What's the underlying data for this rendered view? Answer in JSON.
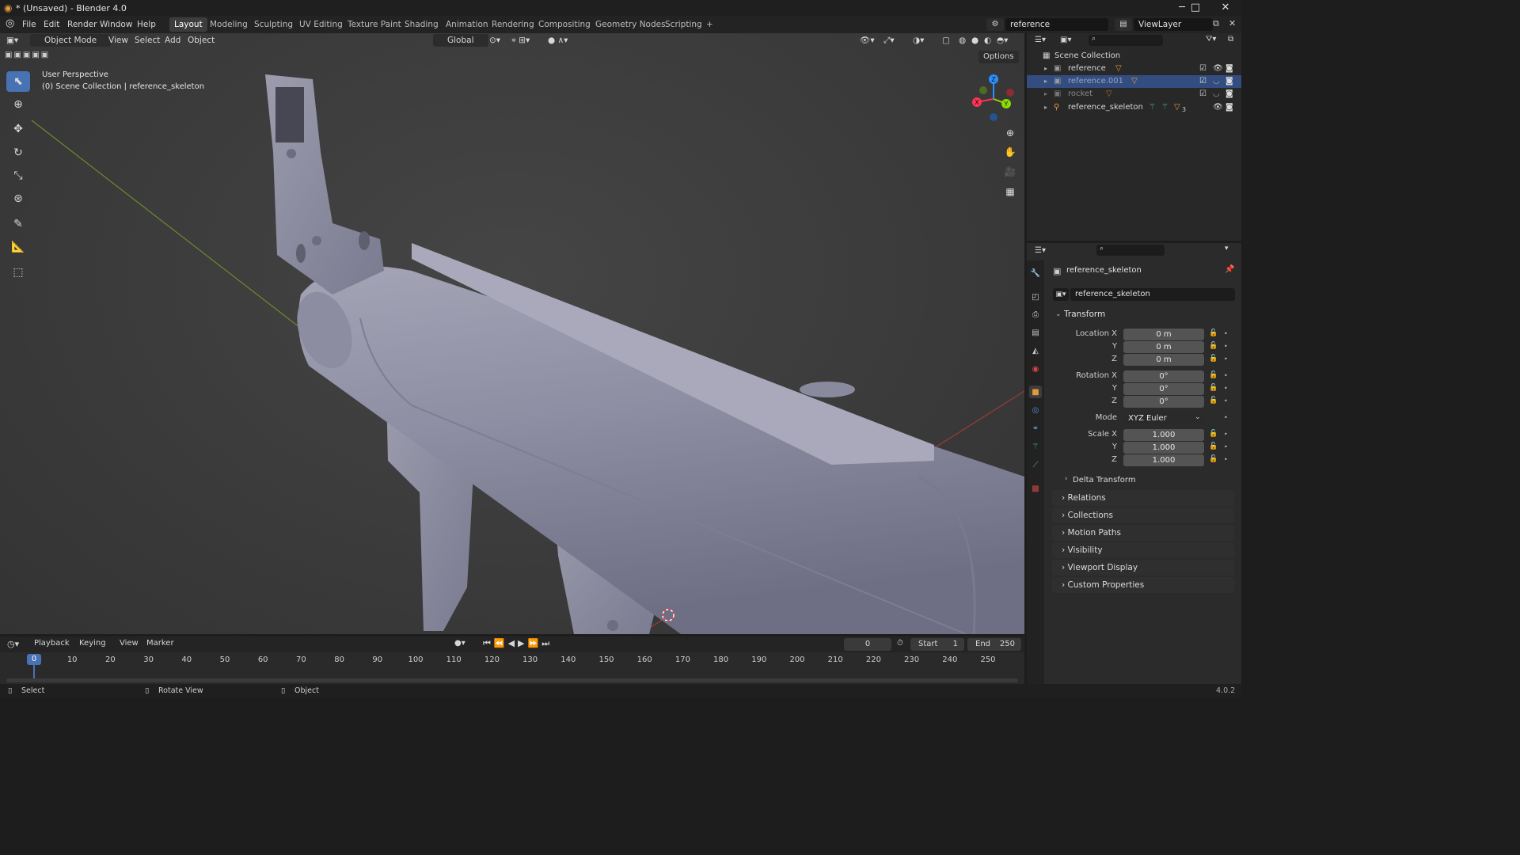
{
  "window": {
    "title": "* (Unsaved) - Blender 4.0",
    "minimize": "─",
    "maximize": "□",
    "close": "✕"
  },
  "menu": {
    "items": [
      "File",
      "Edit",
      "Render",
      "Window",
      "Help"
    ]
  },
  "workspaces": {
    "tabs": [
      "Layout",
      "Modeling",
      "Sculpting",
      "UV Editing",
      "Texture Paint",
      "Shading",
      "Animation",
      "Rendering",
      "Compositing",
      "Geometry Nodes",
      "Scripting"
    ],
    "active": "Layout",
    "add": "+"
  },
  "scene_field": {
    "value": "reference"
  },
  "viewlayer_field": {
    "value": "ViewLayer"
  },
  "viewport_header": {
    "mode": "Object Mode",
    "menus": [
      "View",
      "Select",
      "Add",
      "Object"
    ],
    "orientation": "Global",
    "options": "Options"
  },
  "viewport_overlay": {
    "perspective": "User Perspective",
    "context": "(0) Scene Collection | reference_skeleton"
  },
  "gizmo": {
    "z": "Z",
    "y": "Y",
    "x": "X"
  },
  "outliner": {
    "root": "Scene Collection",
    "items": [
      {
        "name": "reference",
        "state": "normal"
      },
      {
        "name": "reference.001",
        "state": "selected"
      },
      {
        "name": "rocket",
        "state": "dim"
      },
      {
        "name": "reference_skeleton",
        "state": "normal",
        "badge": "3"
      }
    ]
  },
  "properties": {
    "object_name": "reference_skeleton",
    "datablock": "reference_skeleton",
    "transform_header": "Transform",
    "location": {
      "label": "Location X",
      "x": "0 m",
      "y": "0 m",
      "z": "0 m"
    },
    "rotation": {
      "label": "Rotation X",
      "x": "0°",
      "y": "0°",
      "z": "0°"
    },
    "mode": {
      "label": "Mode",
      "value": "XYZ Euler"
    },
    "scale": {
      "label": "Scale X",
      "x": "1.000",
      "y": "1.000",
      "z": "1.000"
    },
    "axis_y": "Y",
    "axis_z": "Z",
    "delta_transform": "Delta Transform",
    "sections": [
      "Relations",
      "Collections",
      "Motion Paths",
      "Visibility",
      "Viewport Display",
      "Custom Properties"
    ]
  },
  "timeline": {
    "menus": [
      "Playback",
      "Keying",
      "View",
      "Marker"
    ],
    "current_frame": "0",
    "start_label": "Start",
    "start": "1",
    "end_label": "End",
    "end": "250",
    "ticks": [
      "0",
      "10",
      "20",
      "30",
      "40",
      "50",
      "60",
      "70",
      "80",
      "90",
      "100",
      "110",
      "120",
      "130",
      "140",
      "150",
      "160",
      "170",
      "180",
      "190",
      "200",
      "210",
      "220",
      "230",
      "240",
      "250"
    ]
  },
  "statusbar": {
    "select": "Select",
    "rotate": "Rotate View",
    "object": "Object",
    "version": "4.0.2"
  },
  "colors": {
    "accent": "#4772b3",
    "selected_row": "#334d80",
    "x_axis": "#ff3352",
    "y_axis": "#8bdc00",
    "z_axis": "#2890ff",
    "orange": "#e59a3a"
  }
}
